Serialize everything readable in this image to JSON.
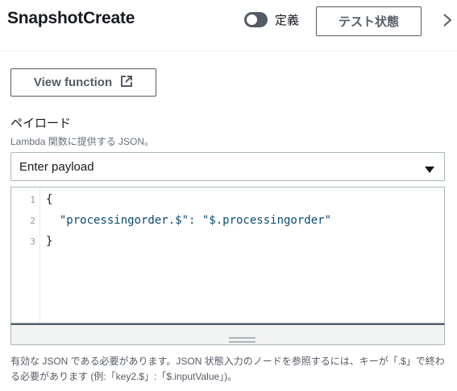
{
  "header": {
    "title": "SnapshotCreate",
    "toggle_label": "定義",
    "test_state_button": "テスト状態"
  },
  "view_function_button": "View function",
  "payload": {
    "label": "ペイロード",
    "description": "Lambda 関数に提供する JSON。",
    "select_value": "Enter payload"
  },
  "editor": {
    "line_numbers": [
      "1",
      "2",
      "3"
    ],
    "lines": [
      "{",
      "  \"processingorder.$\": \"$.processingorder\"",
      "}"
    ]
  },
  "help_text": "有効な JSON である必要があります。JSON 状態入力のノードを参照するには、キーが「.$」で終わる必要があります (例:「key2.$」:「$.inputValue」)。"
}
